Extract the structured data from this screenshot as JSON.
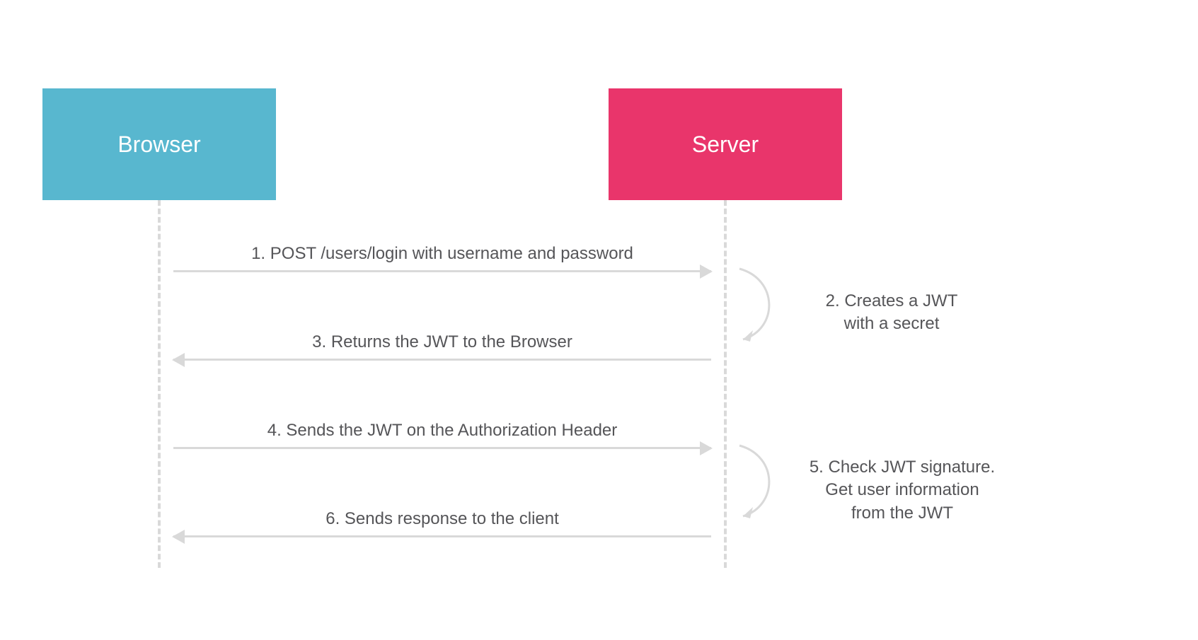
{
  "nodes": {
    "browser": {
      "label": "Browser",
      "color": "#58b7cf"
    },
    "server": {
      "label": "Server",
      "color": "#e9356b"
    }
  },
  "steps": {
    "s1": "1. POST /users/login with username and password",
    "s2_line1": "2. Creates a JWT",
    "s2_line2": "with a secret",
    "s3": "3. Returns the JWT to the Browser",
    "s4": "4. Sends the JWT on the Authorization Header",
    "s5_line1": "5. Check JWT signature.",
    "s5_line2": "Get user information",
    "s5_line3": "from the JWT",
    "s6": "6. Sends response to the client"
  }
}
